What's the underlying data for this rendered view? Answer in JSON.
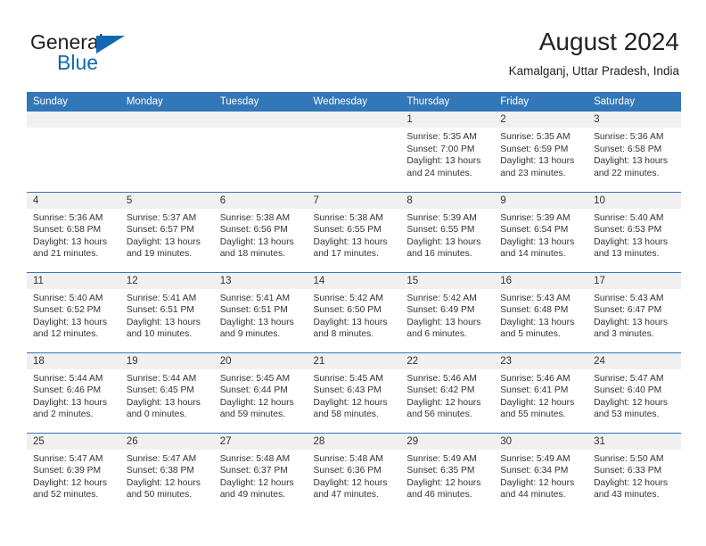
{
  "brand": {
    "name_part1": "General",
    "name_part2": "Blue",
    "triangle_icon": "triangle-icon",
    "accent_color": "#1268b3"
  },
  "header": {
    "month_title": "August 2024",
    "location": "Kamalganj, Uttar Pradesh, India"
  },
  "calendar": {
    "header_bg": "#3277b8",
    "daynum_bg": "#f0f0f0",
    "weekday_headers": [
      "Sunday",
      "Monday",
      "Tuesday",
      "Wednesday",
      "Thursday",
      "Friday",
      "Saturday"
    ],
    "weeks": [
      [
        {
          "day": ""
        },
        {
          "day": ""
        },
        {
          "day": ""
        },
        {
          "day": ""
        },
        {
          "day": "1",
          "sunrise": "Sunrise: 5:35 AM",
          "sunset": "Sunset: 7:00 PM",
          "daylight_line1": "Daylight: 13 hours",
          "daylight_line2": "and 24 minutes."
        },
        {
          "day": "2",
          "sunrise": "Sunrise: 5:35 AM",
          "sunset": "Sunset: 6:59 PM",
          "daylight_line1": "Daylight: 13 hours",
          "daylight_line2": "and 23 minutes."
        },
        {
          "day": "3",
          "sunrise": "Sunrise: 5:36 AM",
          "sunset": "Sunset: 6:58 PM",
          "daylight_line1": "Daylight: 13 hours",
          "daylight_line2": "and 22 minutes."
        }
      ],
      [
        {
          "day": "4",
          "sunrise": "Sunrise: 5:36 AM",
          "sunset": "Sunset: 6:58 PM",
          "daylight_line1": "Daylight: 13 hours",
          "daylight_line2": "and 21 minutes."
        },
        {
          "day": "5",
          "sunrise": "Sunrise: 5:37 AM",
          "sunset": "Sunset: 6:57 PM",
          "daylight_line1": "Daylight: 13 hours",
          "daylight_line2": "and 19 minutes."
        },
        {
          "day": "6",
          "sunrise": "Sunrise: 5:38 AM",
          "sunset": "Sunset: 6:56 PM",
          "daylight_line1": "Daylight: 13 hours",
          "daylight_line2": "and 18 minutes."
        },
        {
          "day": "7",
          "sunrise": "Sunrise: 5:38 AM",
          "sunset": "Sunset: 6:55 PM",
          "daylight_line1": "Daylight: 13 hours",
          "daylight_line2": "and 17 minutes."
        },
        {
          "day": "8",
          "sunrise": "Sunrise: 5:39 AM",
          "sunset": "Sunset: 6:55 PM",
          "daylight_line1": "Daylight: 13 hours",
          "daylight_line2": "and 16 minutes."
        },
        {
          "day": "9",
          "sunrise": "Sunrise: 5:39 AM",
          "sunset": "Sunset: 6:54 PM",
          "daylight_line1": "Daylight: 13 hours",
          "daylight_line2": "and 14 minutes."
        },
        {
          "day": "10",
          "sunrise": "Sunrise: 5:40 AM",
          "sunset": "Sunset: 6:53 PM",
          "daylight_line1": "Daylight: 13 hours",
          "daylight_line2": "and 13 minutes."
        }
      ],
      [
        {
          "day": "11",
          "sunrise": "Sunrise: 5:40 AM",
          "sunset": "Sunset: 6:52 PM",
          "daylight_line1": "Daylight: 13 hours",
          "daylight_line2": "and 12 minutes."
        },
        {
          "day": "12",
          "sunrise": "Sunrise: 5:41 AM",
          "sunset": "Sunset: 6:51 PM",
          "daylight_line1": "Daylight: 13 hours",
          "daylight_line2": "and 10 minutes."
        },
        {
          "day": "13",
          "sunrise": "Sunrise: 5:41 AM",
          "sunset": "Sunset: 6:51 PM",
          "daylight_line1": "Daylight: 13 hours",
          "daylight_line2": "and 9 minutes."
        },
        {
          "day": "14",
          "sunrise": "Sunrise: 5:42 AM",
          "sunset": "Sunset: 6:50 PM",
          "daylight_line1": "Daylight: 13 hours",
          "daylight_line2": "and 8 minutes."
        },
        {
          "day": "15",
          "sunrise": "Sunrise: 5:42 AM",
          "sunset": "Sunset: 6:49 PM",
          "daylight_line1": "Daylight: 13 hours",
          "daylight_line2": "and 6 minutes."
        },
        {
          "day": "16",
          "sunrise": "Sunrise: 5:43 AM",
          "sunset": "Sunset: 6:48 PM",
          "daylight_line1": "Daylight: 13 hours",
          "daylight_line2": "and 5 minutes."
        },
        {
          "day": "17",
          "sunrise": "Sunrise: 5:43 AM",
          "sunset": "Sunset: 6:47 PM",
          "daylight_line1": "Daylight: 13 hours",
          "daylight_line2": "and 3 minutes."
        }
      ],
      [
        {
          "day": "18",
          "sunrise": "Sunrise: 5:44 AM",
          "sunset": "Sunset: 6:46 PM",
          "daylight_line1": "Daylight: 13 hours",
          "daylight_line2": "and 2 minutes."
        },
        {
          "day": "19",
          "sunrise": "Sunrise: 5:44 AM",
          "sunset": "Sunset: 6:45 PM",
          "daylight_line1": "Daylight: 13 hours",
          "daylight_line2": "and 0 minutes."
        },
        {
          "day": "20",
          "sunrise": "Sunrise: 5:45 AM",
          "sunset": "Sunset: 6:44 PM",
          "daylight_line1": "Daylight: 12 hours",
          "daylight_line2": "and 59 minutes."
        },
        {
          "day": "21",
          "sunrise": "Sunrise: 5:45 AM",
          "sunset": "Sunset: 6:43 PM",
          "daylight_line1": "Daylight: 12 hours",
          "daylight_line2": "and 58 minutes."
        },
        {
          "day": "22",
          "sunrise": "Sunrise: 5:46 AM",
          "sunset": "Sunset: 6:42 PM",
          "daylight_line1": "Daylight: 12 hours",
          "daylight_line2": "and 56 minutes."
        },
        {
          "day": "23",
          "sunrise": "Sunrise: 5:46 AM",
          "sunset": "Sunset: 6:41 PM",
          "daylight_line1": "Daylight: 12 hours",
          "daylight_line2": "and 55 minutes."
        },
        {
          "day": "24",
          "sunrise": "Sunrise: 5:47 AM",
          "sunset": "Sunset: 6:40 PM",
          "daylight_line1": "Daylight: 12 hours",
          "daylight_line2": "and 53 minutes."
        }
      ],
      [
        {
          "day": "25",
          "sunrise": "Sunrise: 5:47 AM",
          "sunset": "Sunset: 6:39 PM",
          "daylight_line1": "Daylight: 12 hours",
          "daylight_line2": "and 52 minutes."
        },
        {
          "day": "26",
          "sunrise": "Sunrise: 5:47 AM",
          "sunset": "Sunset: 6:38 PM",
          "daylight_line1": "Daylight: 12 hours",
          "daylight_line2": "and 50 minutes."
        },
        {
          "day": "27",
          "sunrise": "Sunrise: 5:48 AM",
          "sunset": "Sunset: 6:37 PM",
          "daylight_line1": "Daylight: 12 hours",
          "daylight_line2": "and 49 minutes."
        },
        {
          "day": "28",
          "sunrise": "Sunrise: 5:48 AM",
          "sunset": "Sunset: 6:36 PM",
          "daylight_line1": "Daylight: 12 hours",
          "daylight_line2": "and 47 minutes."
        },
        {
          "day": "29",
          "sunrise": "Sunrise: 5:49 AM",
          "sunset": "Sunset: 6:35 PM",
          "daylight_line1": "Daylight: 12 hours",
          "daylight_line2": "and 46 minutes."
        },
        {
          "day": "30",
          "sunrise": "Sunrise: 5:49 AM",
          "sunset": "Sunset: 6:34 PM",
          "daylight_line1": "Daylight: 12 hours",
          "daylight_line2": "and 44 minutes."
        },
        {
          "day": "31",
          "sunrise": "Sunrise: 5:50 AM",
          "sunset": "Sunset: 6:33 PM",
          "daylight_line1": "Daylight: 12 hours",
          "daylight_line2": "and 43 minutes."
        }
      ]
    ]
  }
}
